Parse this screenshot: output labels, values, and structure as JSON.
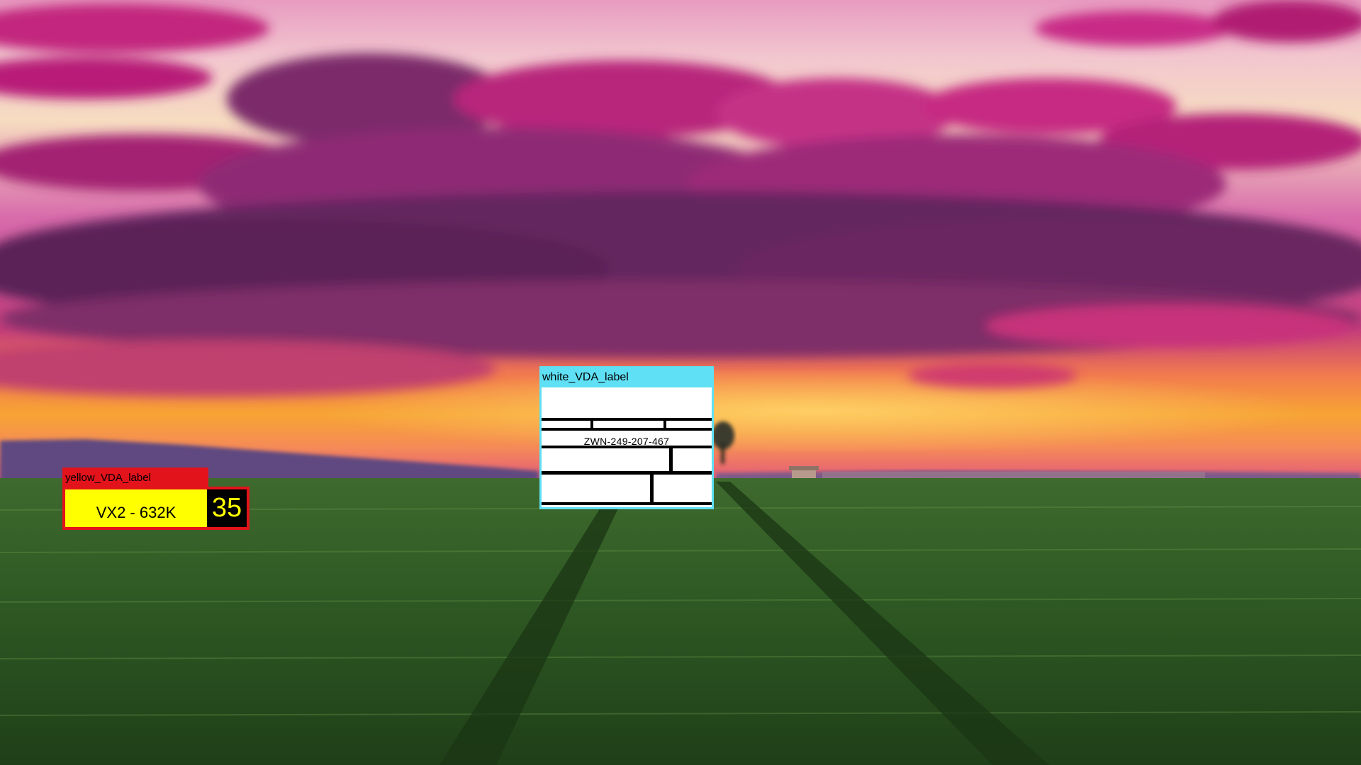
{
  "wallpaper": {
    "description_icon": "sunset-wheat-field-wallpaper",
    "colors": {
      "sky_top": "#f0b7c8",
      "cloud_magenta": "#c8287e",
      "cloud_dark": "#5a2456",
      "horizon_orange": "#f59a2a",
      "field_green": "#2f5a22"
    }
  },
  "yellow_window": {
    "title": "yellow_VDA_label",
    "field_text": "VX2 - 632K",
    "count": "35",
    "colors": {
      "frame": "#e3131b",
      "field": "#ffff00",
      "count_bg": "#000000",
      "count_text": "#ffff00"
    }
  },
  "white_window": {
    "title": "white_VDA_label",
    "code": "ZWN-249-207-467",
    "colors": {
      "frame": "#5fe0f4",
      "body": "#ffffff",
      "lines": "#000000"
    }
  }
}
